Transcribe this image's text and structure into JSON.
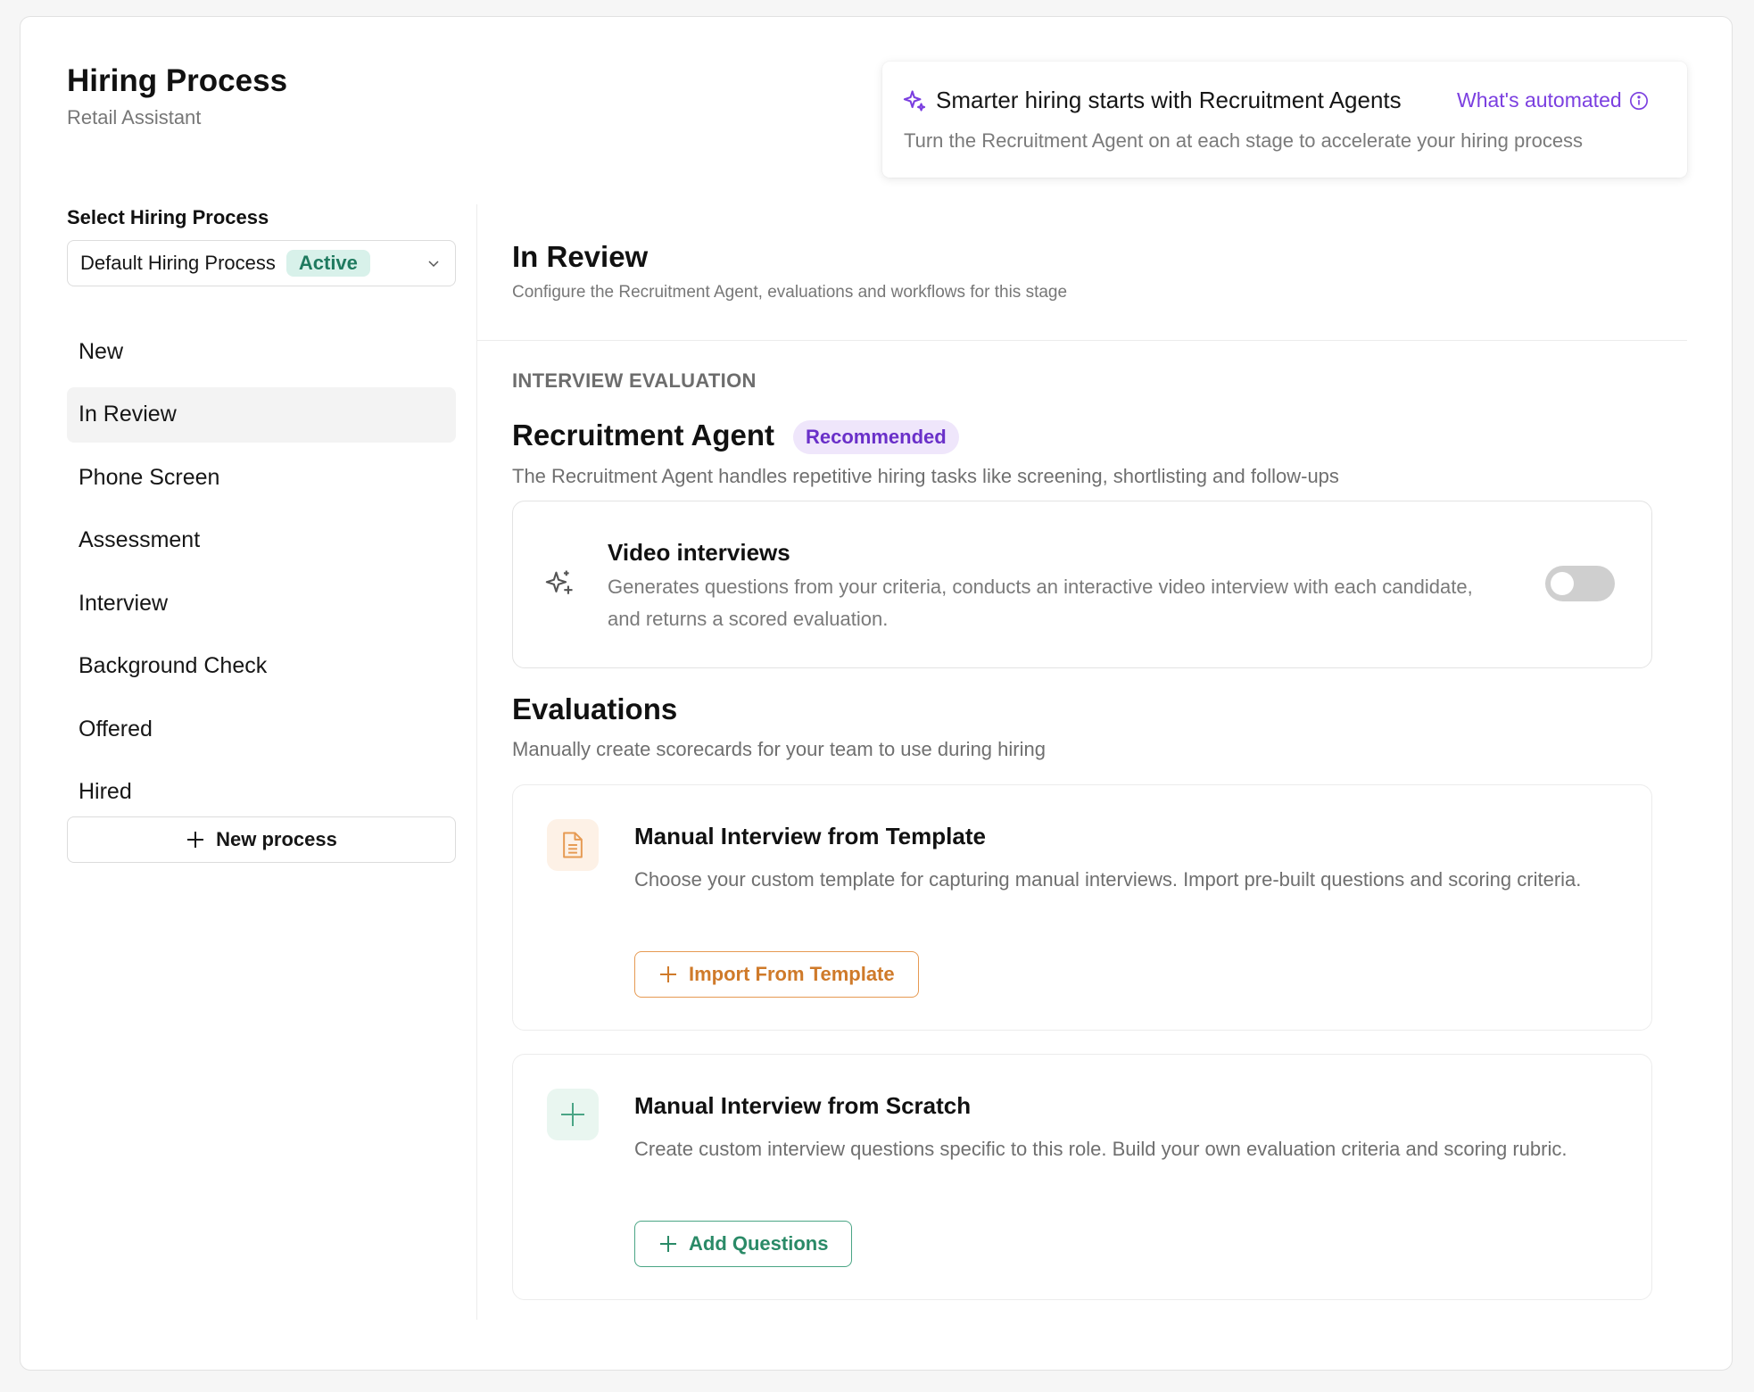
{
  "header": {
    "title": "Hiring Process",
    "subtitle": "Retail Assistant"
  },
  "promo": {
    "title": "Smarter hiring starts with Recruitment Agents",
    "link": "What's automated",
    "description": "Turn the Recruitment Agent on at each stage to accelerate your hiring process",
    "accent_color": "#7b3fe0"
  },
  "sidebar": {
    "select_label": "Select Hiring Process",
    "select_value": "Default Hiring Process",
    "select_badge": "Active",
    "stages": [
      {
        "label": "New"
      },
      {
        "label": "In Review"
      },
      {
        "label": "Phone Screen"
      },
      {
        "label": "Assessment"
      },
      {
        "label": "Interview"
      },
      {
        "label": "Background Check"
      },
      {
        "label": "Offered"
      },
      {
        "label": "Hired"
      }
    ],
    "active_stage_index": 1,
    "new_process_label": "New process"
  },
  "main": {
    "stage_title": "In Review",
    "stage_description": "Configure the Recruitment Agent, evaluations and workflows for this stage",
    "section_label": "INTERVIEW EVALUATION",
    "agent": {
      "title": "Recruitment Agent",
      "badge": "Recommended",
      "description": "The Recruitment Agent handles repetitive hiring tasks like screening, shortlisting and follow-ups",
      "video": {
        "title": "Video interviews",
        "description": "Generates questions from your criteria, conducts an interactive video interview with each candidate, and returns a scored evaluation.",
        "enabled": false
      }
    },
    "evaluations": {
      "title": "Evaluations",
      "description": "Manually create scorecards for your team to use during hiring",
      "options": [
        {
          "title": "Manual Interview from Template",
          "description": "Choose your custom template for capturing manual interviews. Import pre-built questions and scoring criteria.",
          "button": "Import From Template",
          "icon": "document-icon",
          "color": "#cf7a2a"
        },
        {
          "title": "Manual Interview from Scratch",
          "description": "Create custom interview questions specific to this role. Build your own evaluation criteria and scoring rubric.",
          "button": "Add Questions",
          "icon": "plus-icon",
          "color": "#2a8a67"
        }
      ]
    }
  }
}
